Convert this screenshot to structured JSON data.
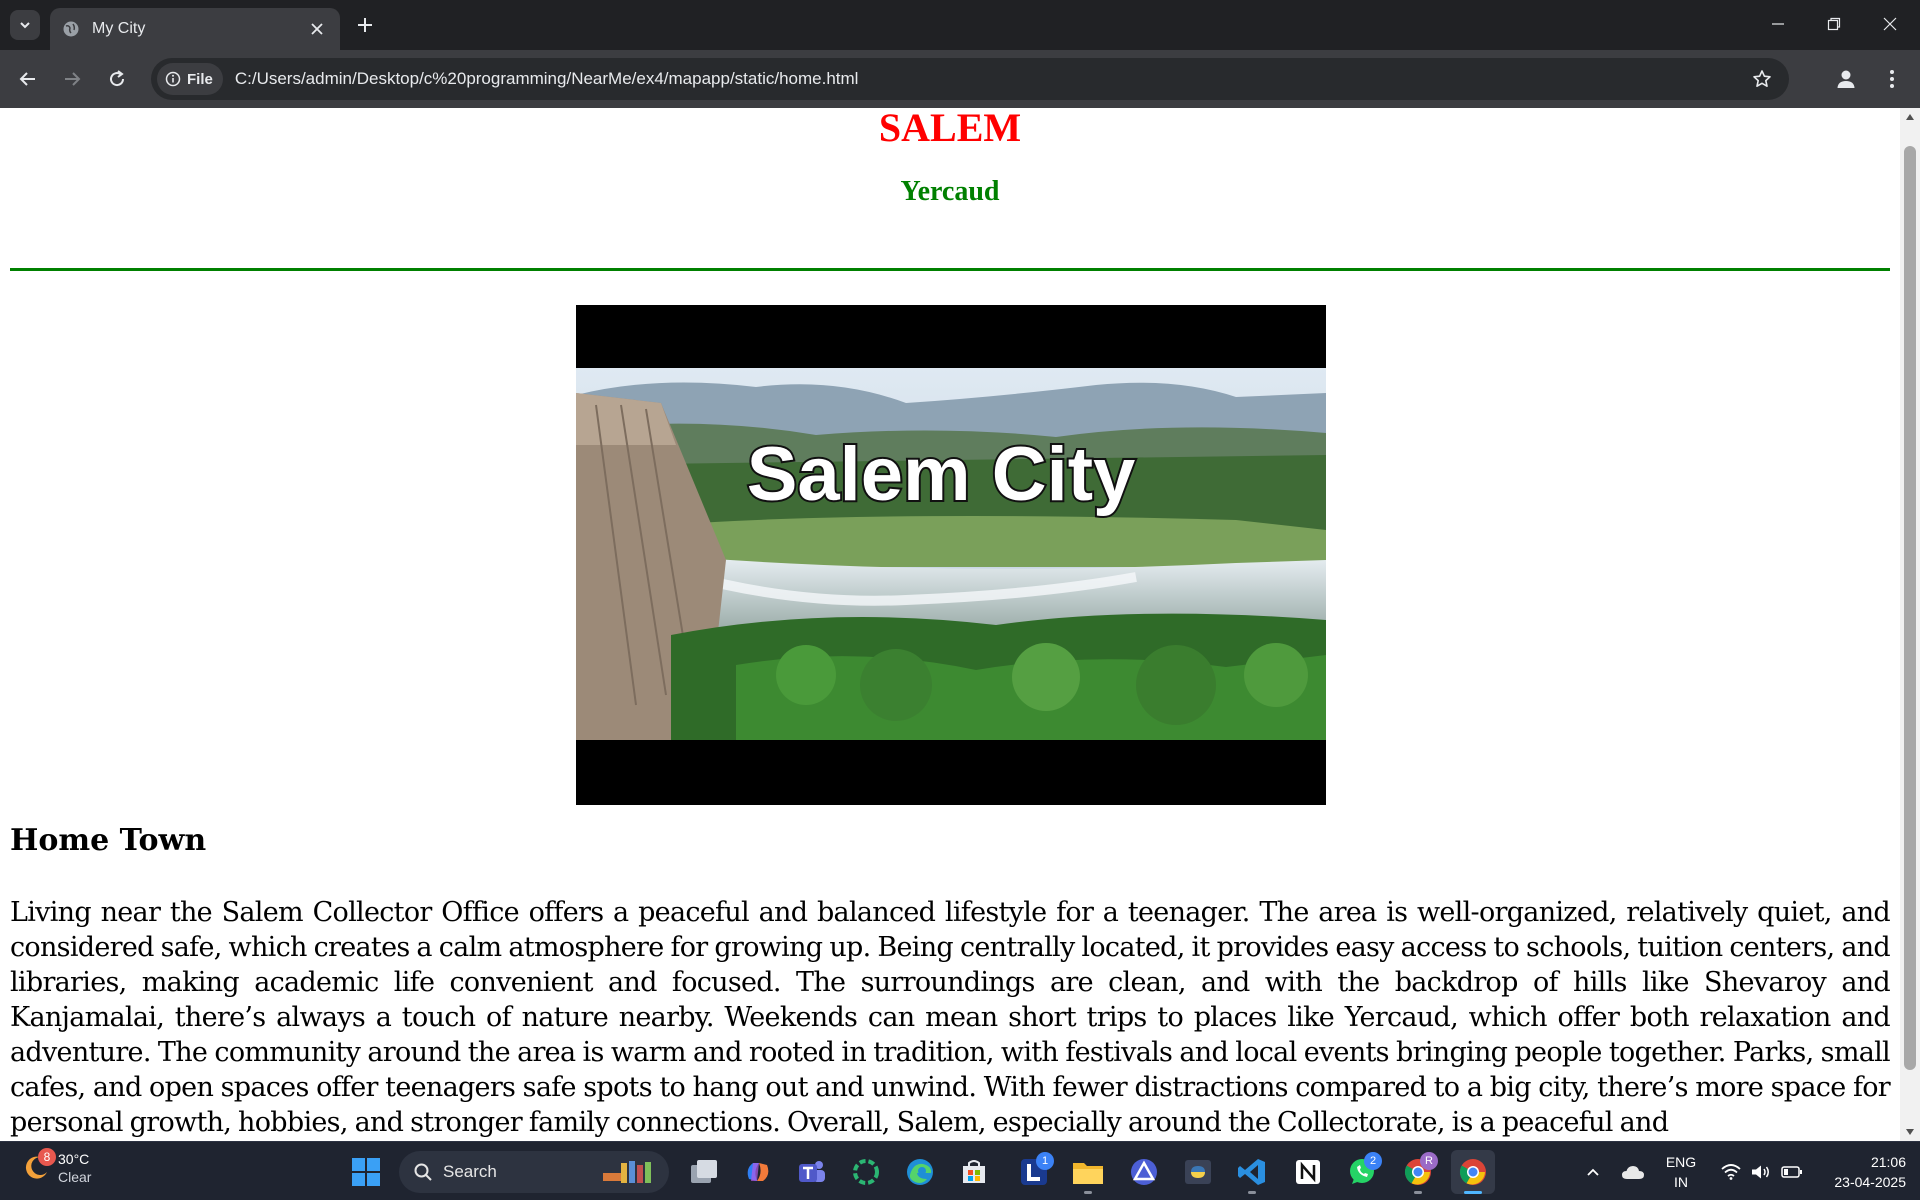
{
  "browser": {
    "tab_title": "My City",
    "site_chip": "File",
    "url": "C:/Users/admin/Desktop/c%20programming/NearMe/ex4/mapapp/static/home.html"
  },
  "page": {
    "heading": "SALEM",
    "subheading": "Yercaud",
    "hero_caption": "Salem City",
    "section_title": "Home Town",
    "paragraph": "Living near the Salem Collector Office offers a peaceful and balanced lifestyle for a teenager. The area is well-organized, relatively quiet, and considered safe, which creates a calm atmosphere for growing up. Being centrally located, it provides easy access to schools, tuition centers, and libraries, making academic life convenient and focused. The surroundings are clean, and with the backdrop of hills like Shevaroy and Kanjamalai, there’s always a touch of nature nearby. Weekends can mean short trips to places like Yercaud, which offer both relaxation and adventure. The community around the area is warm and rooted in tradition, with festivals and local events bringing people together. Parks, small cafes, and open spaces offer teenagers safe spots to hang out and unwind. With fewer distractions compared to a big city, there’s more space for personal growth, hobbies, and stronger family connections. Overall, Salem, especially around the Collectorate, is a peaceful and"
  },
  "colors": {
    "heading": "#ff0000",
    "subheading": "#008000",
    "rule": "#008000"
  },
  "taskbar": {
    "weather_badge": "8",
    "weather_temp": "30°C",
    "weather_condition": "Clear",
    "search_label": "Search",
    "lens_badge": "1",
    "whatsapp_badge": "2",
    "chrome_profile_badge": "R",
    "language_line1": "ENG",
    "language_line2": "IN",
    "time": "21:06",
    "date": "23-04-2025"
  }
}
